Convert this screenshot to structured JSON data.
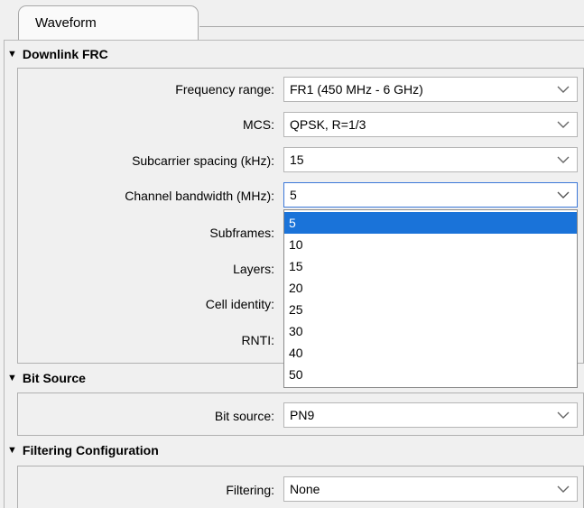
{
  "tab": {
    "label": "Waveform"
  },
  "sections": {
    "downlink": {
      "title": "Downlink FRC",
      "fields": [
        {
          "label": "Frequency range:",
          "value": "FR1 (450 MHz - 6 GHz)"
        },
        {
          "label": "MCS:",
          "value": "QPSK, R=1/3"
        },
        {
          "label": "Subcarrier spacing (kHz):",
          "value": "15"
        },
        {
          "label": "Channel bandwidth (MHz):",
          "value": "5"
        },
        {
          "label": "Subframes:"
        },
        {
          "label": "Layers:"
        },
        {
          "label": "Cell identity:"
        },
        {
          "label": "RNTI:"
        }
      ]
    },
    "bit_source": {
      "title": "Bit Source",
      "fields": [
        {
          "label": "Bit source:",
          "value": "PN9"
        }
      ]
    },
    "filtering": {
      "title": "Filtering Configuration",
      "fields": [
        {
          "label": "Filtering:",
          "value": "None"
        }
      ]
    }
  },
  "dropdown": {
    "selected": "5",
    "options": [
      "5",
      "10",
      "15",
      "20",
      "25",
      "30",
      "40",
      "50"
    ]
  },
  "icons": {
    "combo_arrow": "chevron-down-icon",
    "collapse": "triangle-down-icon"
  },
  "colors": {
    "selection": "#1a73d9",
    "focus_border": "#3c78d8"
  }
}
